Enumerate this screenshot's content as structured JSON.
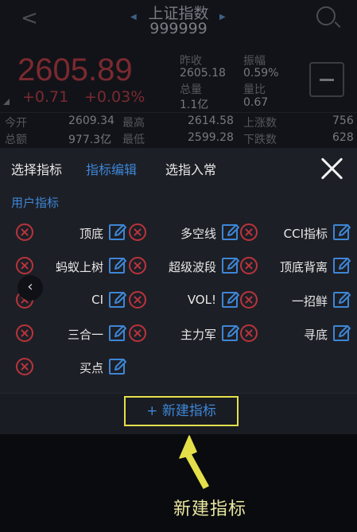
{
  "quote": {
    "title": "上证指数",
    "code": "999999",
    "price": "2605.89",
    "change": "+0.71",
    "change_pct": "+0.03%",
    "stats": [
      {
        "label": "昨收",
        "value": "2605.18"
      },
      {
        "label": "振幅",
        "value": "0.59%"
      },
      {
        "label": "总量",
        "value": "1.1亿"
      },
      {
        "label": "量比",
        "value": "0.67"
      }
    ],
    "rows": [
      {
        "l1": "今开",
        "v1": "2609.34",
        "l2": "最高",
        "v2": "2614.58",
        "l3": "上涨数",
        "v3": "756"
      },
      {
        "l1": "总额",
        "v1": "977.3亿",
        "l2": "最低",
        "v2": "2599.28",
        "l3": "下跌数",
        "v3": "628"
      }
    ]
  },
  "tabs": [
    {
      "label": "选择指标"
    },
    {
      "label": "指标编辑"
    },
    {
      "label": "选指入常"
    }
  ],
  "section_title": "用户指标",
  "indicators": [
    {
      "name": "顶底"
    },
    {
      "name": "多空线"
    },
    {
      "name": "CCI指标"
    },
    {
      "name": "蚂蚁上树"
    },
    {
      "name": "超级波段"
    },
    {
      "name": "顶底背离"
    },
    {
      "name": "CI"
    },
    {
      "name": "VOL!"
    },
    {
      "name": "一招鲜"
    },
    {
      "name": "三合一"
    },
    {
      "name": "主力军"
    },
    {
      "name": "寻底"
    },
    {
      "name": "买点"
    }
  ],
  "new_button": "+ 新建指标",
  "annotation": "新建指标",
  "colors": {
    "accent": "#3d86d6",
    "delete": "#b9343c",
    "highlight": "#e3e04a"
  },
  "icons": {
    "delete": "delete-circle-icon",
    "edit": "edit-pencil-icon",
    "close": "close-icon",
    "collapse": "chevron-left-icon"
  }
}
